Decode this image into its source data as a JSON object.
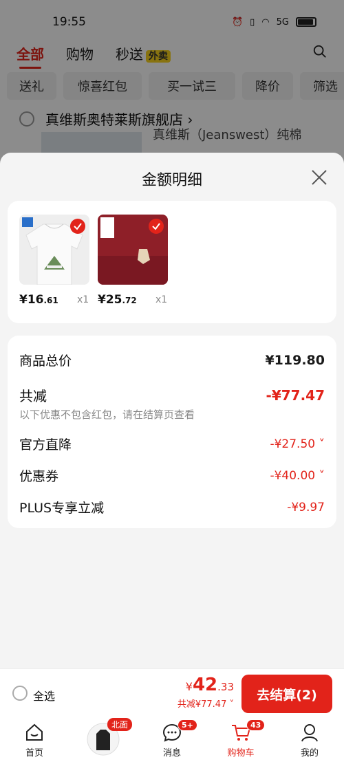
{
  "status_bar": {
    "time": "19:55",
    "network": "5G"
  },
  "top_nav": {
    "tabs": [
      "全部",
      "购物",
      "秒送"
    ],
    "waimai_badge": "外卖"
  },
  "filter_chips": [
    "送礼",
    "惊喜红包",
    "买一试三",
    "降价",
    "筛选"
  ],
  "store": {
    "name": "真维斯奥特莱斯旗舰店",
    "product_title": "真维斯（Jeanswest）纯棉"
  },
  "sheet": {
    "title": "金额明细",
    "products": [
      {
        "price_int": "¥16",
        "price_dec": ".61",
        "qty": "x1"
      },
      {
        "price_int": "¥25",
        "price_dec": ".72",
        "qty": "x1"
      }
    ],
    "summary": {
      "goods_total_label": "商品总价",
      "goods_total": "¥119.80",
      "discount_label": "共减",
      "discount_total": "-¥77.47",
      "discount_note": "以下优惠不包含红包，请在结算页查看",
      "items": [
        {
          "label": "官方直降",
          "value": "-¥27.50"
        },
        {
          "label": "优惠券",
          "value": "-¥40.00"
        },
        {
          "label": "PLUS专享立减",
          "value": "-¥9.97"
        }
      ]
    }
  },
  "bottom_bar": {
    "select_all": "全选",
    "total_symbol": "¥",
    "total_int": "42",
    "total_dec": ".33",
    "total_discount": "共减¥77.47",
    "checkout_label": "去结算(2)"
  },
  "tab_bar": {
    "items": [
      {
        "label": "首页"
      },
      {
        "label": "",
        "promo": "北面"
      },
      {
        "label": "消息",
        "badge": "5+"
      },
      {
        "label": "购物车",
        "badge": "43"
      },
      {
        "label": "我的"
      }
    ]
  },
  "colors": {
    "accent": "#e2231a"
  }
}
